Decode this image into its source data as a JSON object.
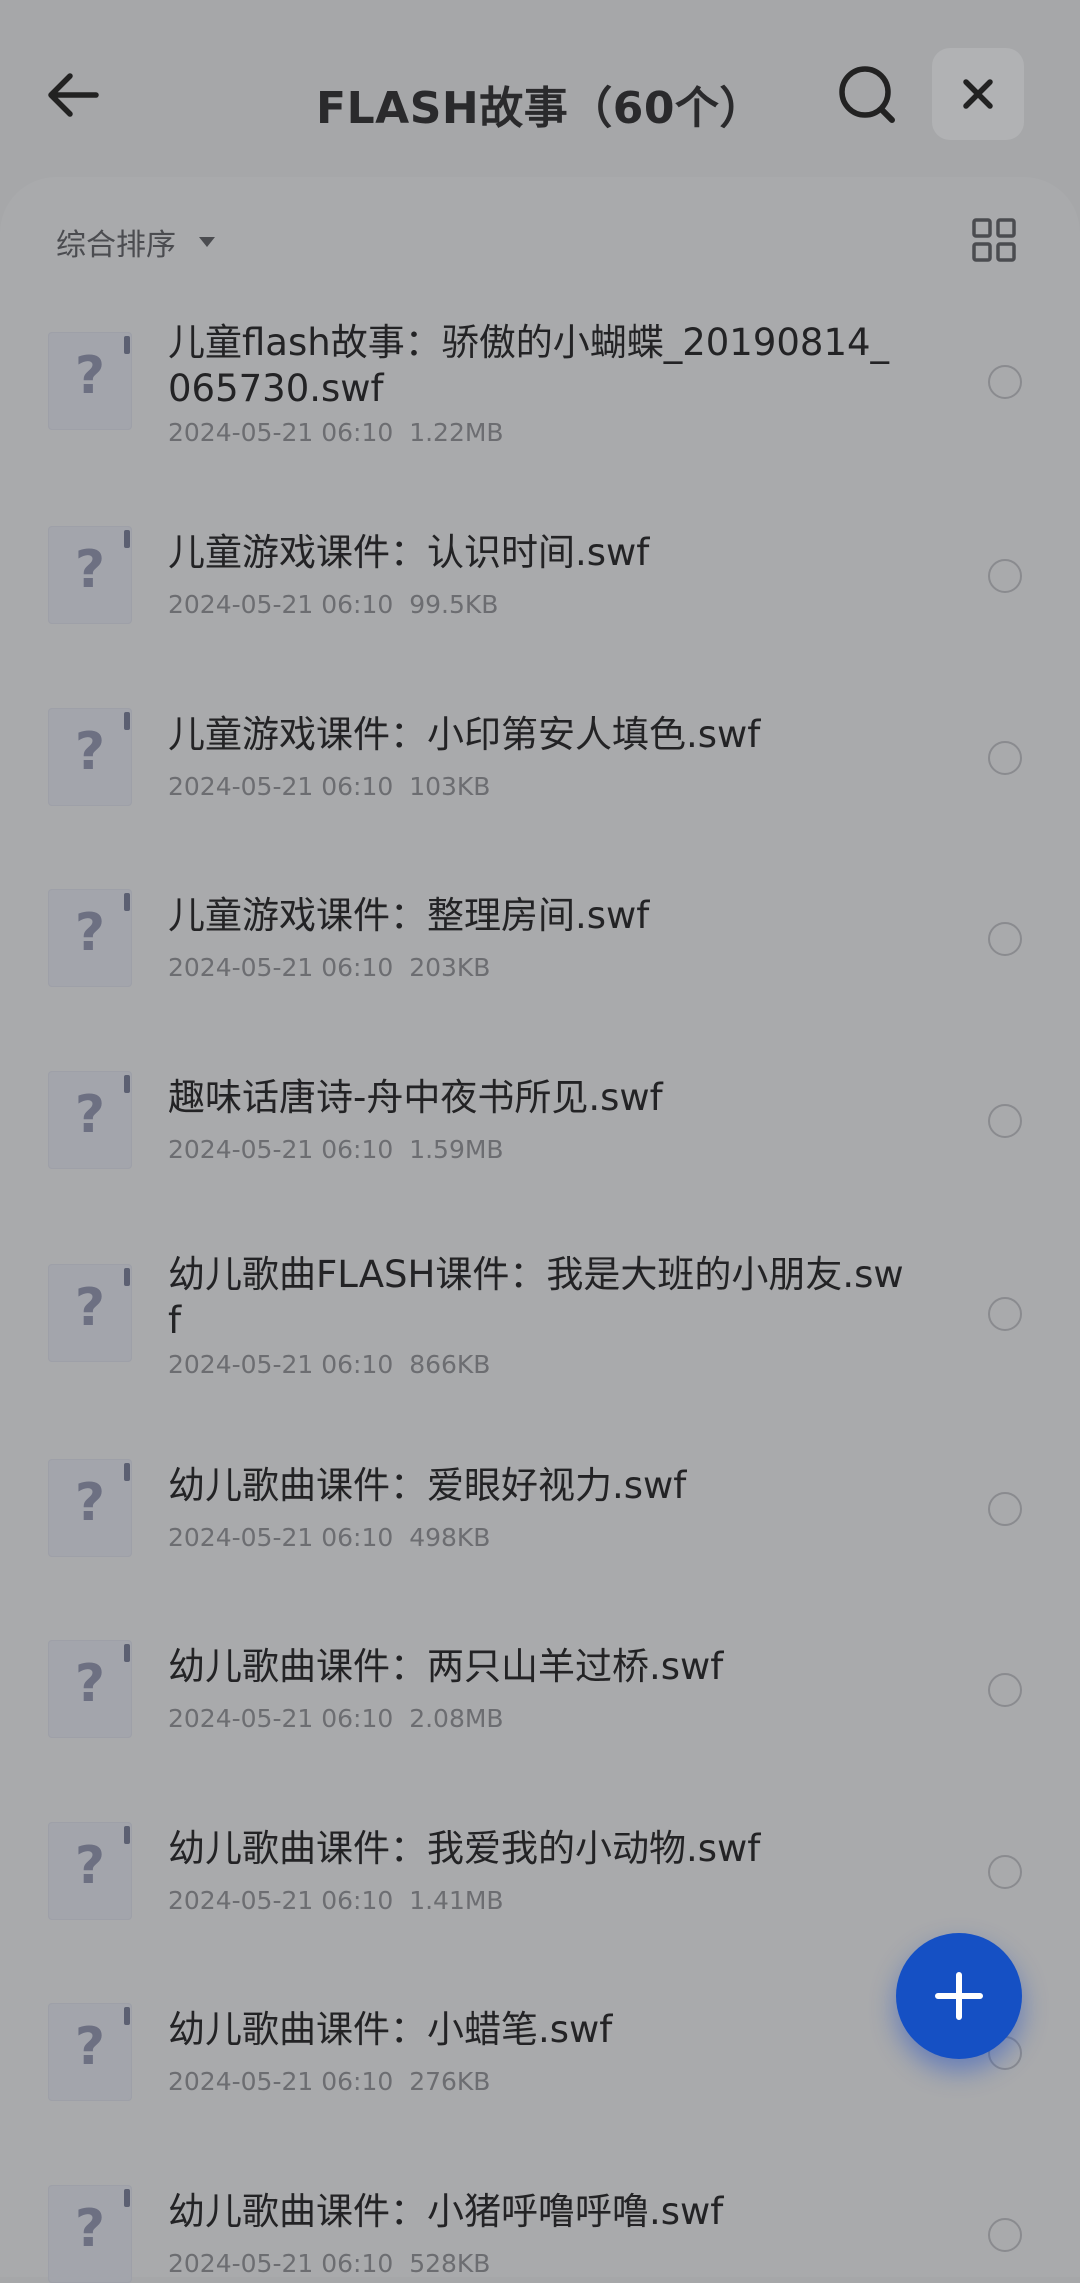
{
  "header": {
    "title": "FLASH故事（60个）",
    "back_icon": "arrow-left-icon",
    "search_icon": "search-icon",
    "close_icon": "close-icon"
  },
  "toolbar": {
    "sort_label": "综合排序",
    "sort_icon": "caret-down-icon",
    "view_icon": "grid-view-icon"
  },
  "files": [
    {
      "name": "儿童flash故事：骄傲的小蝴蝶_20190814_065730.swf",
      "date": "2024-05-21 06:10",
      "size": "1.22MB"
    },
    {
      "name": "儿童游戏课件：认识时间.swf",
      "date": "2024-05-21 06:10",
      "size": "99.5KB"
    },
    {
      "name": "儿童游戏课件：小印第安人填色.swf",
      "date": "2024-05-21 06:10",
      "size": "103KB"
    },
    {
      "name": "儿童游戏课件：整理房间.swf",
      "date": "2024-05-21 06:10",
      "size": "203KB"
    },
    {
      "name": "趣味话唐诗-舟中夜书所见.swf",
      "date": "2024-05-21 06:10",
      "size": "1.59MB"
    },
    {
      "name": "幼儿歌曲FLASH课件：我是大班的小朋友.swf",
      "date": "2024-05-21 06:10",
      "size": "866KB"
    },
    {
      "name": "幼儿歌曲课件：爱眼好视力.swf",
      "date": "2024-05-21 06:10",
      "size": "498KB"
    },
    {
      "name": "幼儿歌曲课件：两只山羊过桥.swf",
      "date": "2024-05-21 06:10",
      "size": "2.08MB"
    },
    {
      "name": "幼儿歌曲课件：我爱我的小动物.swf",
      "date": "2024-05-21 06:10",
      "size": "1.41MB"
    },
    {
      "name": "幼儿歌曲课件：小蜡笔.swf",
      "date": "2024-05-21 06:10",
      "size": "276KB"
    },
    {
      "name": "幼儿歌曲课件：小猪呼噜呼噜.swf",
      "date": "2024-05-21 06:10",
      "size": "528KB"
    }
  ],
  "file_icon": {
    "glyph": "?",
    "name": "unknown-file-icon"
  },
  "fab": {
    "icon": "plus-icon"
  },
  "colors": {
    "fab": "#1550c4",
    "overlay": "#a6a7a9"
  }
}
